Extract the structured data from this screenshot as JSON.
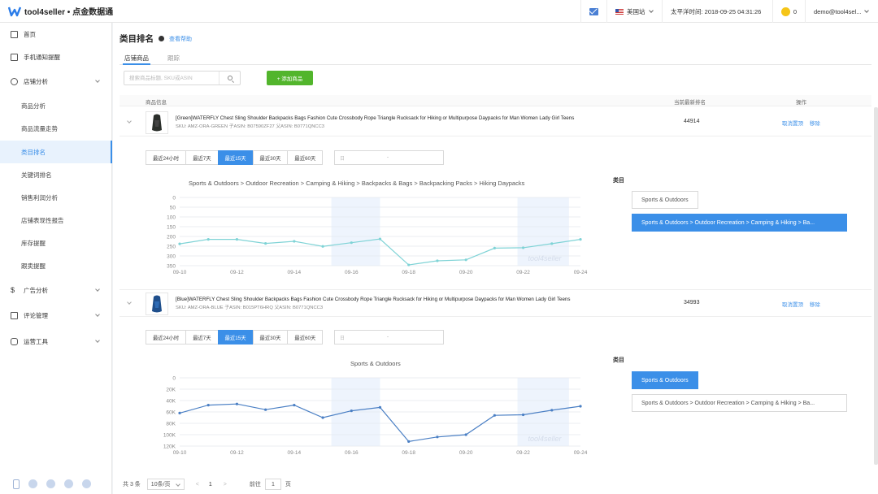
{
  "header": {
    "logo_text": "tool4seller • 点金数据通",
    "site": "美国站",
    "time_label": "太平洋时间: 2018-09-25 04:31:26",
    "coins": "0",
    "user": "demo@tool4sel..."
  },
  "sidebar": {
    "items": [
      {
        "label": "首页",
        "icon": "grid-icon"
      },
      {
        "label": "手机通知提醒",
        "icon": "tablet-icon"
      },
      {
        "label": "店铺分析",
        "icon": "eye-icon",
        "expandable": true
      },
      {
        "label": "商品分析"
      },
      {
        "label": "商品流量走势"
      },
      {
        "label": "类目排名",
        "active": true
      },
      {
        "label": "关键词排名"
      },
      {
        "label": "销售利润分析"
      },
      {
        "label": "店铺表现性报告"
      },
      {
        "label": "库存提醒"
      },
      {
        "label": "跟卖提醒"
      },
      {
        "label": "广告分析",
        "icon": "dollar-icon",
        "expandable": true
      },
      {
        "label": "评论管理",
        "icon": "mail-icon",
        "expandable": true
      },
      {
        "label": "运营工具",
        "icon": "briefcase-icon",
        "expandable": true
      }
    ]
  },
  "page": {
    "title": "类目排名",
    "help": "查看帮助",
    "tabs": [
      "店铺商品",
      "跟踪"
    ],
    "search_placeholder": "搜索商品标题, SKU或ASIN",
    "add_button": "+ 添加商品",
    "columns": {
      "product": "商品信息",
      "rank": "当前最新排名",
      "ops": "操作"
    }
  },
  "ranges": [
    "最近24小时",
    "最近7天",
    "最近15天",
    "最近30天",
    "最近60天"
  ],
  "active_range": "最近15天",
  "date_placeholder": "日",
  "date_dash": "-",
  "category_label": "类目",
  "products": [
    {
      "title": "[Green]WATERFLY Chest Sling Shoulder Backpacks Bags Fashion Cute Crossbody Rope Triangle Rucksack for Hiking or Multipurpose Daypacks for Man Women Lady Girl Teens",
      "sku": "SKU: AMZ-ORA-GREEN    子ASIN: B07590ZF27    父ASIN: B0771QNCC3",
      "rank": "44914",
      "ops": [
        "取消置顶",
        "移除"
      ],
      "chart_title": "Sports & Outdoors > Outdoor Recreation > Camping & Hiking > Backpacks & Bags > Backpacking Packs > Hiking Daypacks",
      "categories": [
        {
          "label": "Sports & Outdoors",
          "active": false
        },
        {
          "label": "Sports & Outdoors > Outdoor Recreation > Camping & Hiking > Ba...",
          "active": true
        }
      ]
    },
    {
      "title": "[Blue]WATERFLY Chest Sling Shoulder Backpacks Bags Fashion Cute Crossbody Rope Triangle Rucksack for Hiking or Multipurpose Daypacks for Man Women Lady Girl Teens",
      "sku": "SKU: AMZ-ORA-BLUE    子ASIN: B015PT6HRQ    父ASIN: B0771QNCC3",
      "rank": "34993",
      "ops": [
        "取消置顶",
        "移除"
      ],
      "chart_title": "Sports & Outdoors",
      "categories": [
        {
          "label": "Sports & Outdoors",
          "active": true
        },
        {
          "label": "Sports & Outdoors > Outdoor Recreation > Camping & Hiking > Ba...",
          "active": false
        }
      ]
    }
  ],
  "chart_data": [
    {
      "type": "line",
      "title": "Sports & Outdoors > Outdoor Recreation > Camping & Hiking > Backpacks & Bags > Backpacking Packs > Hiking Daypacks",
      "x": [
        "09-10",
        "09-11",
        "09-12",
        "09-13",
        "09-14",
        "09-15",
        "09-16",
        "09-17",
        "09-18",
        "09-19",
        "09-20",
        "09-21",
        "09-22",
        "09-23",
        "09-24"
      ],
      "xticks": [
        "09-10",
        "09-12",
        "09-14",
        "09-16",
        "09-18",
        "09-20",
        "09-22",
        "09-24"
      ],
      "values": [
        238,
        215,
        215,
        236,
        225,
        251,
        232,
        213,
        346,
        325,
        320,
        260,
        258,
        237,
        215
      ],
      "yticks": [
        "0",
        "50",
        "100",
        "150",
        "200",
        "250",
        "300",
        "350"
      ],
      "ylim": [
        0,
        350
      ],
      "y_inverted": true,
      "color": "#7fd3d6",
      "watermark": "tool4seller"
    },
    {
      "type": "line",
      "title": "Sports & Outdoors",
      "x": [
        "09-10",
        "09-11",
        "09-12",
        "09-13",
        "09-14",
        "09-15",
        "09-16",
        "09-17",
        "09-18",
        "09-19",
        "09-20",
        "09-21",
        "09-22",
        "09-23",
        "09-24"
      ],
      "xticks": [
        "09-10",
        "09-12",
        "09-14",
        "09-16",
        "09-18",
        "09-20",
        "09-22",
        "09-24"
      ],
      "values": [
        62000,
        48000,
        46000,
        56000,
        48000,
        70000,
        58000,
        52000,
        112000,
        104000,
        100000,
        66000,
        65000,
        57000,
        50000
      ],
      "yticks": [
        "0",
        "20K",
        "40K",
        "60K",
        "80K",
        "100K",
        "120K"
      ],
      "ylim": [
        0,
        120000
      ],
      "y_inverted": true,
      "color": "#4a7fc4",
      "watermark": "tool4seller"
    }
  ],
  "pager": {
    "total": "共 3 条",
    "page_size": "10条/页",
    "prev": "<",
    "current": "1",
    "next": ">",
    "goto": "前往",
    "goto_value": "1",
    "page_suffix": "页"
  }
}
